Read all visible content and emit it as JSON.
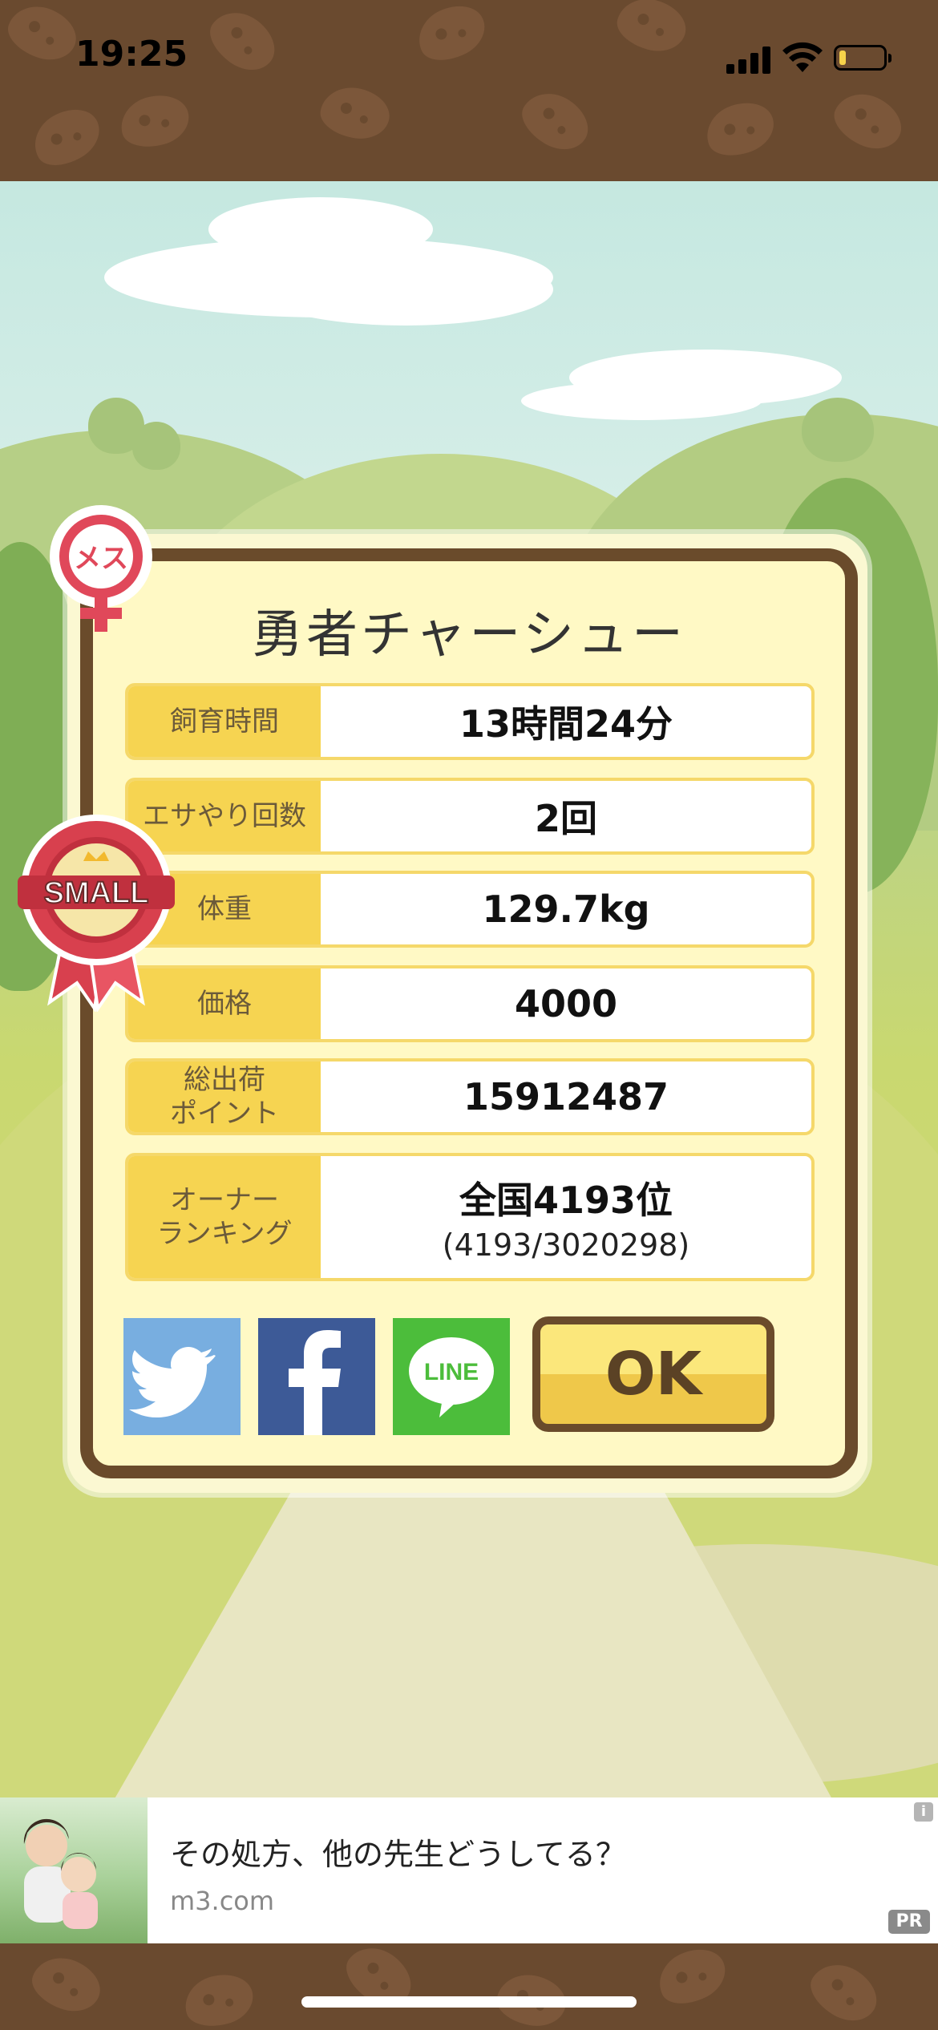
{
  "status_bar": {
    "time": "19:25",
    "battery_level": 0.15
  },
  "icons": {
    "gender_badge": "female-icon",
    "size_badge": "ribbon-icon"
  },
  "gender_label": "メス",
  "size_badge_label": "SMALL",
  "dialog": {
    "title": "勇者チャーシュー",
    "rows": [
      {
        "label": "飼育時間",
        "value": "13時間24分"
      },
      {
        "label": "エサやり回数",
        "value": "2回"
      },
      {
        "label": "体重",
        "value": "129.7kg"
      },
      {
        "label": "価格",
        "value": "4000"
      },
      {
        "label_line1": "総出荷",
        "label_line2": "ポイント",
        "value": "15912487"
      },
      {
        "label_line1": "オーナー",
        "label_line2": "ランキング",
        "value": "全国4193位",
        "sub": "(4193/3020298)"
      }
    ],
    "share": {
      "twitter": "twitter-icon",
      "facebook": "facebook-icon",
      "line_label": "LINE"
    },
    "ok_label": "OK"
  },
  "ad": {
    "title": "その処方、他の先生どうしてる？",
    "url": "m3.com",
    "pr": "PR",
    "info": "i"
  },
  "colors": {
    "frame": "#6a4b2b",
    "label_bg": "#f6d451",
    "panel_bg": "#fff9c5",
    "twitter": "#78aee0",
    "facebook": "#3d5a97",
    "line": "#4cbd3b"
  }
}
